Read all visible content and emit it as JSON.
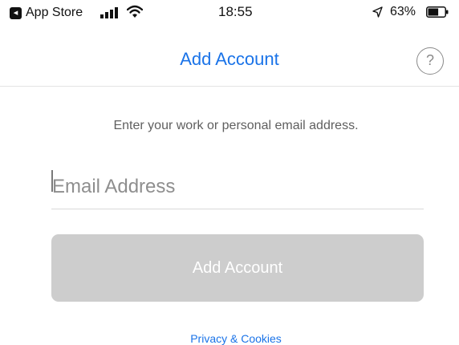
{
  "status_bar": {
    "back_app_label": "App Store",
    "back_app_icon": "back-arrow-icon",
    "time": "18:55",
    "battery_percent": "63%",
    "battery_level": 0.63,
    "signal_icon": "cellular-signal-icon",
    "wifi_icon": "wifi-icon",
    "location_icon": "location-arrow-icon"
  },
  "nav": {
    "title": "Add Account",
    "help_label": "?",
    "help_icon": "help-icon"
  },
  "form": {
    "instruction": "Enter your work or personal email address.",
    "email_placeholder": "Email Address",
    "email_value": "",
    "submit_label": "Add Account"
  },
  "footer": {
    "privacy_label": "Privacy & Cookies"
  },
  "colors": {
    "accent": "#1a73e8",
    "button_disabled": "#cdcdcd",
    "text_muted": "#5f5f5f"
  }
}
